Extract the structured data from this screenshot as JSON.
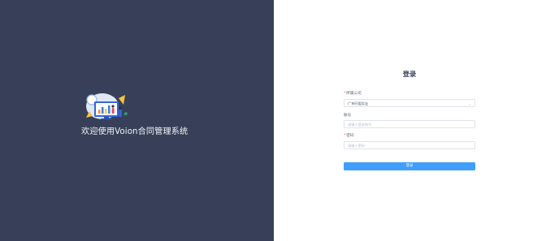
{
  "welcome": {
    "title": "欢迎使用Voion合同管理系统"
  },
  "login": {
    "title": "登录",
    "company": {
      "required_mark": "*",
      "label": "所属公司",
      "value": "广东旺盈实业"
    },
    "account": {
      "label": "账号",
      "placeholder": "请输入登录账号"
    },
    "password": {
      "required_mark": "*",
      "label": "密码",
      "placeholder": "请输入密码"
    },
    "submit_label": "登录"
  },
  "colors": {
    "left_panel_bg": "#374058",
    "primary_button": "#409eff",
    "required_mark": "#f0494a"
  },
  "icons": {
    "illustration": "office-work-illustration",
    "dropdown": "chevron-down-icon"
  }
}
